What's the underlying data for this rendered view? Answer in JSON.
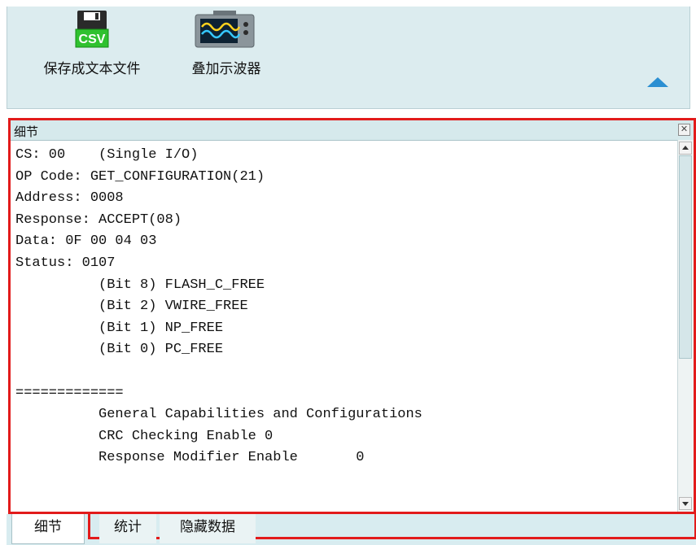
{
  "toolbar": {
    "save_csv": {
      "label": "保存成文本文件",
      "icon": "csv-save-icon",
      "icon_text": "CSV"
    },
    "overlay_scope": {
      "label": "叠加示波器",
      "icon": "oscilloscope-icon"
    },
    "collapse_icon": "triangle-up-icon"
  },
  "details_panel": {
    "title": "细节",
    "content": "CS: 00    (Single I/O)\nOP Code: GET_CONFIGURATION(21)\nAddress: 0008\nResponse: ACCEPT(08)\nData: 0F 00 04 03\nStatus: 0107\n          (Bit 8) FLASH_C_FREE\n          (Bit 2) VWIRE_FREE\n          (Bit 1) NP_FREE\n          (Bit 0) PC_FREE\n\n=============\n          General Capabilities and Configurations\n          CRC Checking Enable 0\n          Response Modifier Enable       0"
  },
  "tabs": {
    "details": "细节",
    "statistics": "统计",
    "hidden_data": "隐藏数据"
  },
  "colors": {
    "highlight": "#e21b1b",
    "panel_bg": "#dcecef",
    "accent_blue": "#2b8fd2"
  }
}
